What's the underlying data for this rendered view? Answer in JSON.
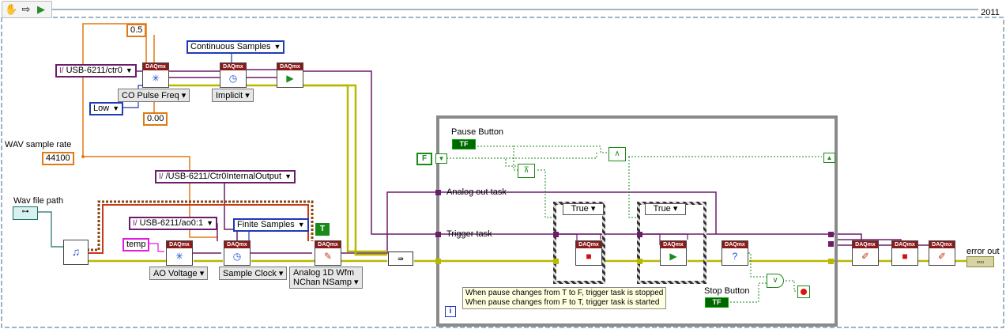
{
  "year_label": "2011",
  "toolbar": {
    "hand_icon": "hand-icon",
    "arrow_icon": "step-arrow-icon",
    "run_icon": "run-icon"
  },
  "constants": {
    "duty_cycle": "0.5",
    "initial_delay": "0.00",
    "sample_rate": "44100",
    "idle_state": "Low",
    "continuous_samples": "Continuous Samples",
    "finite_samples": "Finite Samples",
    "ctr_channel": "USB-6211/ctr0",
    "trigger_terminal": "/USB-6211/Ctr0InternalOutput",
    "ao_channel": "USB-6211/ao0:1",
    "temp": "temp",
    "true_const": "T",
    "false_const": "F"
  },
  "labels": {
    "wav_sample_rate": "WAV sample rate",
    "wav_file_path": "Wav file path",
    "pause_button": "Pause Button",
    "analog_out_task": "Analog out task",
    "trigger_task": "Trigger task",
    "stop_button": "Stop Button",
    "error_out": "error out"
  },
  "selectors": {
    "co_pulse_freq": "CO Pulse Freq",
    "implicit": "Implicit",
    "ao_voltage": "AO Voltage",
    "sample_clock": "Sample Clock",
    "analog_1d_wfm": "Analog 1D Wfm\nNChan NSamp"
  },
  "case_structures": [
    {
      "selector": "True"
    },
    {
      "selector": "True"
    }
  ],
  "nodes": {
    "daqmx_header": "DAQmx"
  },
  "note": {
    "line1": "When pause changes from T to F, trigger task is stopped",
    "line2": "When pause changes from F to T, trigger task is started"
  },
  "loop": {
    "iteration": "i"
  },
  "bool_label": "TF",
  "colors": {
    "wire_orange": "#e07a14",
    "wire_purple": "#6b1d6b",
    "wire_error": "#b8b800",
    "wire_green": "#1a8a1a",
    "wire_pink": "#e01ce0",
    "loop_border": "#8a8a8a",
    "daq_header": "#8b1a1a"
  }
}
